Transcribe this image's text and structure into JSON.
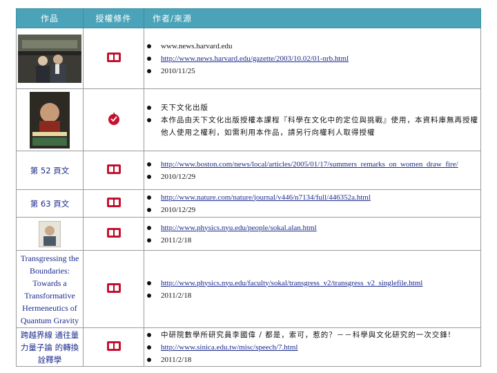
{
  "header": {
    "col_work": "作品",
    "col_license": "授權條件",
    "col_source": "作者/來源"
  },
  "rows": [
    {
      "work_image": "photo-two-men",
      "license_icon": "public-domain-book-icon",
      "sources": [
        "www.news.harvard.edu",
        "http://www.news.harvard.edu/gazette/2003/10.02/01-nrb.html",
        "2010/11/25"
      ]
    },
    {
      "work_image": "book-cover-dalai-lama",
      "license_icon": "licensed-apple-icon",
      "sources": [
        "天下文化出版",
        "本作品由天下文化出版授權本課程『科學在文化中的定位與挑戰』使用，本資料庫無再授權他人使用之權利，如需利用本作品，請另行向權利人取得授權"
      ]
    },
    {
      "work_text": "第 52 頁文",
      "license_icon": "public-domain-book-icon",
      "sources": [
        "http://www.boston.com/news/local/articles/2005/01/17/summers_remarks_on_women_draw_fire/",
        "2010/12/29"
      ]
    },
    {
      "work_text": "第 63 頁文",
      "license_icon": "public-domain-book-icon",
      "sources": [
        "http://www.nature.com/nature/journal/v446/n7134/full/446352a.html",
        "2010/12/29"
      ]
    },
    {
      "work_image": "portrait-photo",
      "license_icon": "public-domain-book-icon",
      "sources": [
        "http://www.physics.nyu.edu/people/sokal.alan.html",
        "2011/2/18"
      ]
    },
    {
      "work_text": "Transgressing the Boundaries: Towards a Transformative Hermeneutics of Quantum Gravity",
      "license_icon": "public-domain-book-icon",
      "sources": [
        "http://www.physics.nyu.edu/faculty/sokal/transgress_v2/transgress_v2_singlefile.html",
        "2011/2/18"
      ]
    },
    {
      "work_text": "跨越界線 通往量力量子論 的轉換詮釋學",
      "license_icon": "public-domain-book-icon",
      "sources": [
        "中研院數學所研究員李國偉 / 都是，索可，惹的？－－科學與文化研究的一次交鋒!",
        "http://www.sinica.edu.tw/misc/speech/7.html",
        "2011/2/18"
      ]
    }
  ],
  "colors": {
    "header_bg": "#4aa3b8",
    "header_text": "#ffffff",
    "link": "#1a2a8c",
    "icon_red": "#c8102e"
  }
}
